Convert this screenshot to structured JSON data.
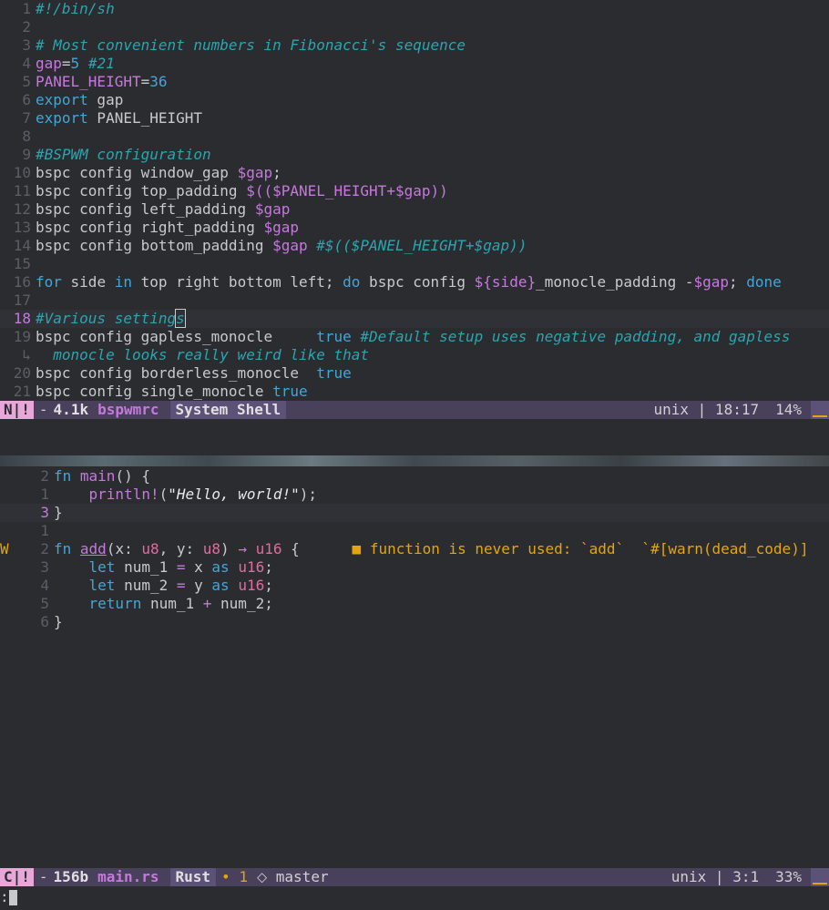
{
  "top_pane": {
    "lines": [
      {
        "n": "1",
        "parts": [
          [
            "c-cmt",
            "#!/bin/sh"
          ]
        ]
      },
      {
        "n": "2",
        "parts": []
      },
      {
        "n": "3",
        "parts": [
          [
            "c-cmt",
            "# Most convenient numbers in Fibonacci's sequence"
          ]
        ]
      },
      {
        "n": "4",
        "parts": [
          [
            "c-var",
            "gap"
          ],
          [
            "",
            "="
          ],
          [
            "c-num",
            "5"
          ],
          [
            "",
            " "
          ],
          [
            "c-cmt",
            "#21"
          ]
        ]
      },
      {
        "n": "5",
        "parts": [
          [
            "c-var",
            "PANEL_HEIGHT"
          ],
          [
            "",
            "="
          ],
          [
            "c-num",
            "36"
          ]
        ]
      },
      {
        "n": "6",
        "parts": [
          [
            "c-kw",
            "export"
          ],
          [
            "",
            " gap"
          ]
        ]
      },
      {
        "n": "7",
        "parts": [
          [
            "c-kw",
            "export"
          ],
          [
            "",
            " PANEL_HEIGHT"
          ]
        ]
      },
      {
        "n": "8",
        "parts": []
      },
      {
        "n": "9",
        "parts": [
          [
            "c-cmt",
            "#BSPWM configuration"
          ]
        ]
      },
      {
        "n": "10",
        "parts": [
          [
            "",
            "bspc config window_gap "
          ],
          [
            "c-var",
            "$gap"
          ],
          [
            "",
            ";"
          ]
        ]
      },
      {
        "n": "11",
        "parts": [
          [
            "",
            "bspc config top_padding "
          ],
          [
            "c-var",
            "$(($PANEL_HEIGHT"
          ],
          [
            "c-op",
            "+"
          ],
          [
            "c-var",
            "$gap))"
          ]
        ]
      },
      {
        "n": "12",
        "parts": [
          [
            "",
            "bspc config left_padding "
          ],
          [
            "c-var",
            "$gap"
          ]
        ]
      },
      {
        "n": "13",
        "parts": [
          [
            "",
            "bspc config right_padding "
          ],
          [
            "c-var",
            "$gap"
          ]
        ]
      },
      {
        "n": "14",
        "parts": [
          [
            "",
            "bspc config bottom_padding "
          ],
          [
            "c-var",
            "$gap"
          ],
          [
            "",
            ""
          ],
          [
            "c-cmt",
            " #$(($PANEL_HEIGHT+$gap))"
          ]
        ]
      },
      {
        "n": "15",
        "parts": []
      },
      {
        "n": "16",
        "parts": [
          [
            "c-kw",
            "for"
          ],
          [
            "",
            " side "
          ],
          [
            "c-kw",
            "in"
          ],
          [
            "",
            " top right bottom left; "
          ],
          [
            "c-kw",
            "do"
          ],
          [
            "",
            " bspc config "
          ],
          [
            "c-var",
            "${side}"
          ],
          [
            "",
            "_monocle_padding -"
          ],
          [
            "c-var",
            "$gap"
          ],
          [
            "",
            "; "
          ],
          [
            "c-kw",
            "done"
          ]
        ]
      },
      {
        "n": "17",
        "parts": []
      },
      {
        "n": "18",
        "cur": true,
        "parts": [
          [
            "c-cmt",
            "#Various setting"
          ],
          [
            "c-cmt cursor",
            "s"
          ]
        ]
      },
      {
        "n": "19",
        "parts": [
          [
            "",
            "bspc config gapless_monocle     "
          ],
          [
            "c-kw",
            "true"
          ],
          [
            "",
            ""
          ],
          [
            "c-cmt",
            " #Default setup uses negative padding, and gapless"
          ]
        ]
      },
      {
        "n": "↳",
        "wrap": true,
        "parts": [
          [
            "c-cmt",
            "  monocle looks really weird like that"
          ]
        ]
      },
      {
        "n": "20",
        "parts": [
          [
            "",
            "bspc config borderless_monocle  "
          ],
          [
            "c-kw",
            "true"
          ]
        ]
      },
      {
        "n": "21",
        "parts": [
          [
            "",
            "bspc config single_monocle "
          ],
          [
            "c-kw",
            "true"
          ]
        ]
      }
    ]
  },
  "top_status": {
    "mode_icons": "N|!",
    "modified": "-",
    "size": "4.1k",
    "filename": "bspwmrc",
    "language": "System Shell",
    "encoding": "unix | 18:17",
    "percent": "14%"
  },
  "bottom_pane": {
    "lines": [
      {
        "n": "2",
        "parts": [
          [
            "c-kw",
            "fn"
          ],
          [
            "",
            ""
          ],
          [
            "c-fn",
            " main"
          ],
          [
            "",
            "() {"
          ]
        ]
      },
      {
        "n": "1",
        "parts": [
          [
            "",
            "    "
          ],
          [
            "c-fn",
            "println!"
          ],
          [
            "",
            "("
          ],
          [
            "c-str",
            "\"Hello, world!\""
          ],
          [
            "",
            ");"
          ]
        ]
      },
      {
        "n": "3",
        "cur": true,
        "parts": [
          [
            "",
            "}"
          ]
        ]
      },
      {
        "n": "1",
        "parts": []
      },
      {
        "n": "2",
        "warn": "W",
        "parts": [
          [
            "c-kw",
            "fn"
          ],
          [
            "",
            " "
          ],
          [
            "c-fnu",
            "add"
          ],
          [
            "",
            "(x: "
          ],
          [
            "c-type",
            "u8"
          ],
          [
            "",
            ", y: "
          ],
          [
            "c-type",
            "u8"
          ],
          [
            "",
            ") "
          ],
          [
            "c-op",
            "→"
          ],
          [
            "",
            ""
          ],
          [
            "c-type",
            " u16"
          ],
          [
            "",
            " {      "
          ],
          [
            "c-warn",
            "■ function is never used: `add`  `#[warn(dead_code)]"
          ]
        ]
      },
      {
        "n": "3",
        "parts": [
          [
            "",
            "    "
          ],
          [
            "c-kw",
            "let"
          ],
          [
            "",
            " num_1 "
          ],
          [
            "c-op",
            "="
          ],
          [
            "",
            " x "
          ],
          [
            "c-kw",
            "as"
          ],
          [
            "c-type",
            " u16"
          ],
          [
            "",
            ";"
          ]
        ]
      },
      {
        "n": "4",
        "parts": [
          [
            "",
            "    "
          ],
          [
            "c-kw",
            "let"
          ],
          [
            "",
            " num_2 "
          ],
          [
            "c-op",
            "="
          ],
          [
            "",
            " y "
          ],
          [
            "c-kw",
            "as"
          ],
          [
            "c-type",
            " u16"
          ],
          [
            "",
            ";"
          ]
        ]
      },
      {
        "n": "5",
        "parts": [
          [
            "",
            "    "
          ],
          [
            "c-kw",
            "return"
          ],
          [
            "",
            " num_1 "
          ],
          [
            "c-op",
            "+"
          ],
          [
            "",
            " num_2;"
          ]
        ]
      },
      {
        "n": "6",
        "parts": [
          [
            "",
            "}"
          ]
        ]
      }
    ]
  },
  "bottom_status": {
    "mode_icons": "C|!",
    "modified": "-",
    "size": "156b",
    "filename": "main.rs",
    "language": "Rust",
    "diag": "• 1",
    "branch_icon": "git-branch-icon",
    "branch": "⬦ master",
    "encoding": "unix | 3:1",
    "percent": "33%"
  },
  "command_line": {
    "prompt": ":"
  }
}
